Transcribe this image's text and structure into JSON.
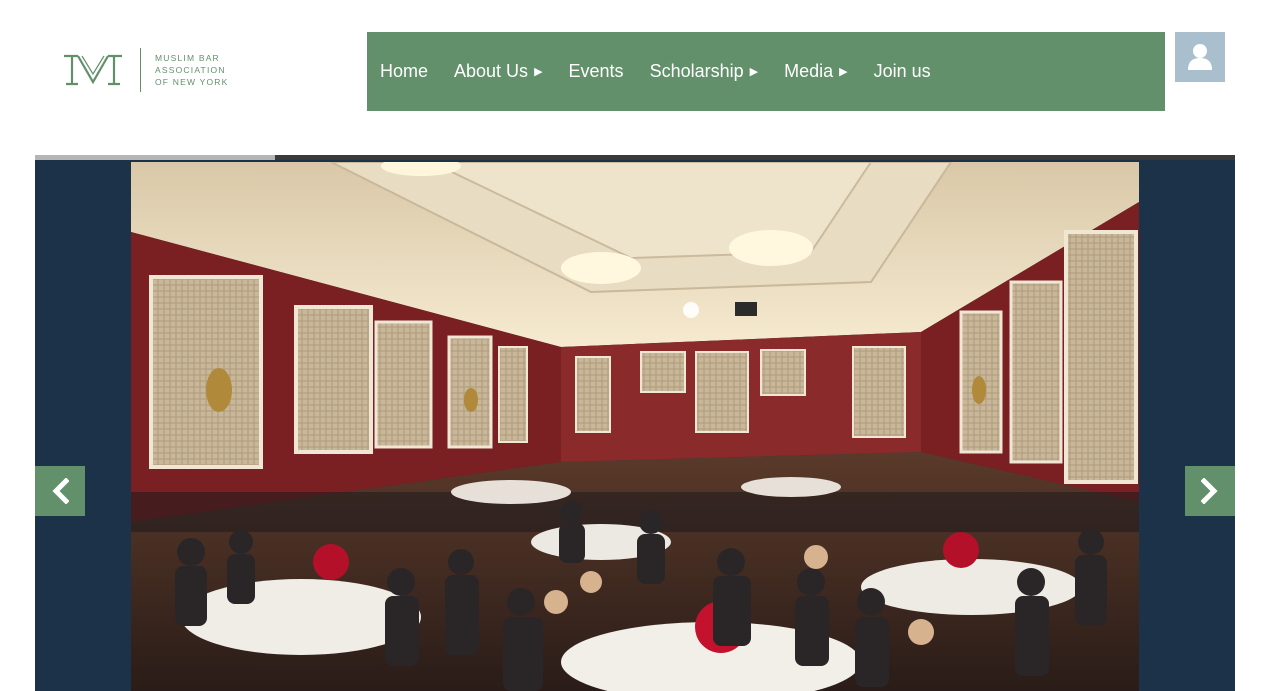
{
  "logo": {
    "line1": "MUSLIM BAR",
    "line2": "ASSOCIATION",
    "line3": "OF NEW YORK",
    "color": "#62906a"
  },
  "nav": {
    "background": "#62906a",
    "items": [
      {
        "label": "Home",
        "has_submenu": false
      },
      {
        "label": "About Us",
        "has_submenu": true
      },
      {
        "label": "Events",
        "has_submenu": false
      },
      {
        "label": "Scholarship",
        "has_submenu": true
      },
      {
        "label": "Media",
        "has_submenu": true
      },
      {
        "label": "Join us",
        "has_submenu": false
      }
    ]
  },
  "user": {
    "icon": "user-icon"
  },
  "slider": {
    "background": "#1c3248",
    "progress": 0.2,
    "prev_icon": "chevron-left-icon",
    "next_icon": "chevron-right-icon",
    "image_description": "banquet-hall-event-photo"
  }
}
